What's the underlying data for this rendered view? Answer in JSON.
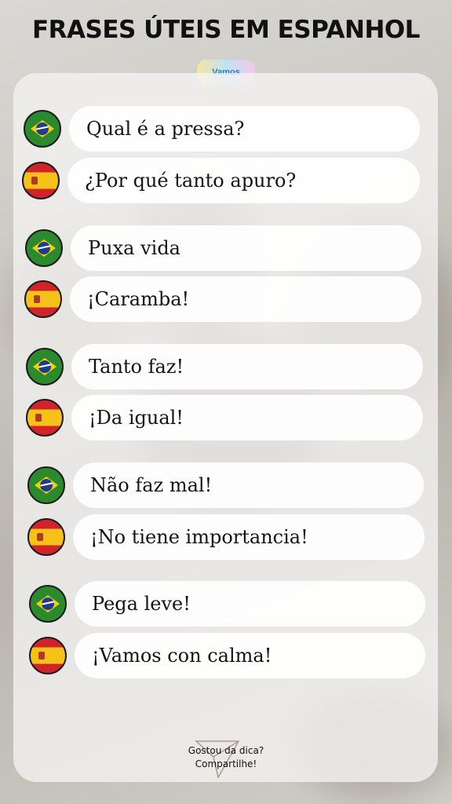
{
  "title": "FRASES ÚTEIS EM ESPANHOL",
  "logo": {
    "text": "Vamos",
    "icon": "vamos-falar-logo"
  },
  "colors": {
    "brazil_green": "#2c8a2e",
    "brazil_yellow": "#f5d000",
    "spain_red": "#d1232a",
    "spain_yellow": "#f6c21a"
  },
  "phrases": [
    {
      "pt": "Qual é a pressa?",
      "es": "¿Por qué tanto apuro?"
    },
    {
      "pt": "Puxa vida",
      "es": "¡Caramba!"
    },
    {
      "pt": "Tanto faz!",
      "es": "¡Da igual!"
    },
    {
      "pt": "Não faz mal!",
      "es": "¡No tiene importancia!"
    },
    {
      "pt": "Pega leve!",
      "es": "¡Vamos con calma!"
    }
  ],
  "footer": {
    "line1": "Gostou da dica?",
    "line2": "Compartilhe!",
    "icon": "share-arrow-icon"
  }
}
